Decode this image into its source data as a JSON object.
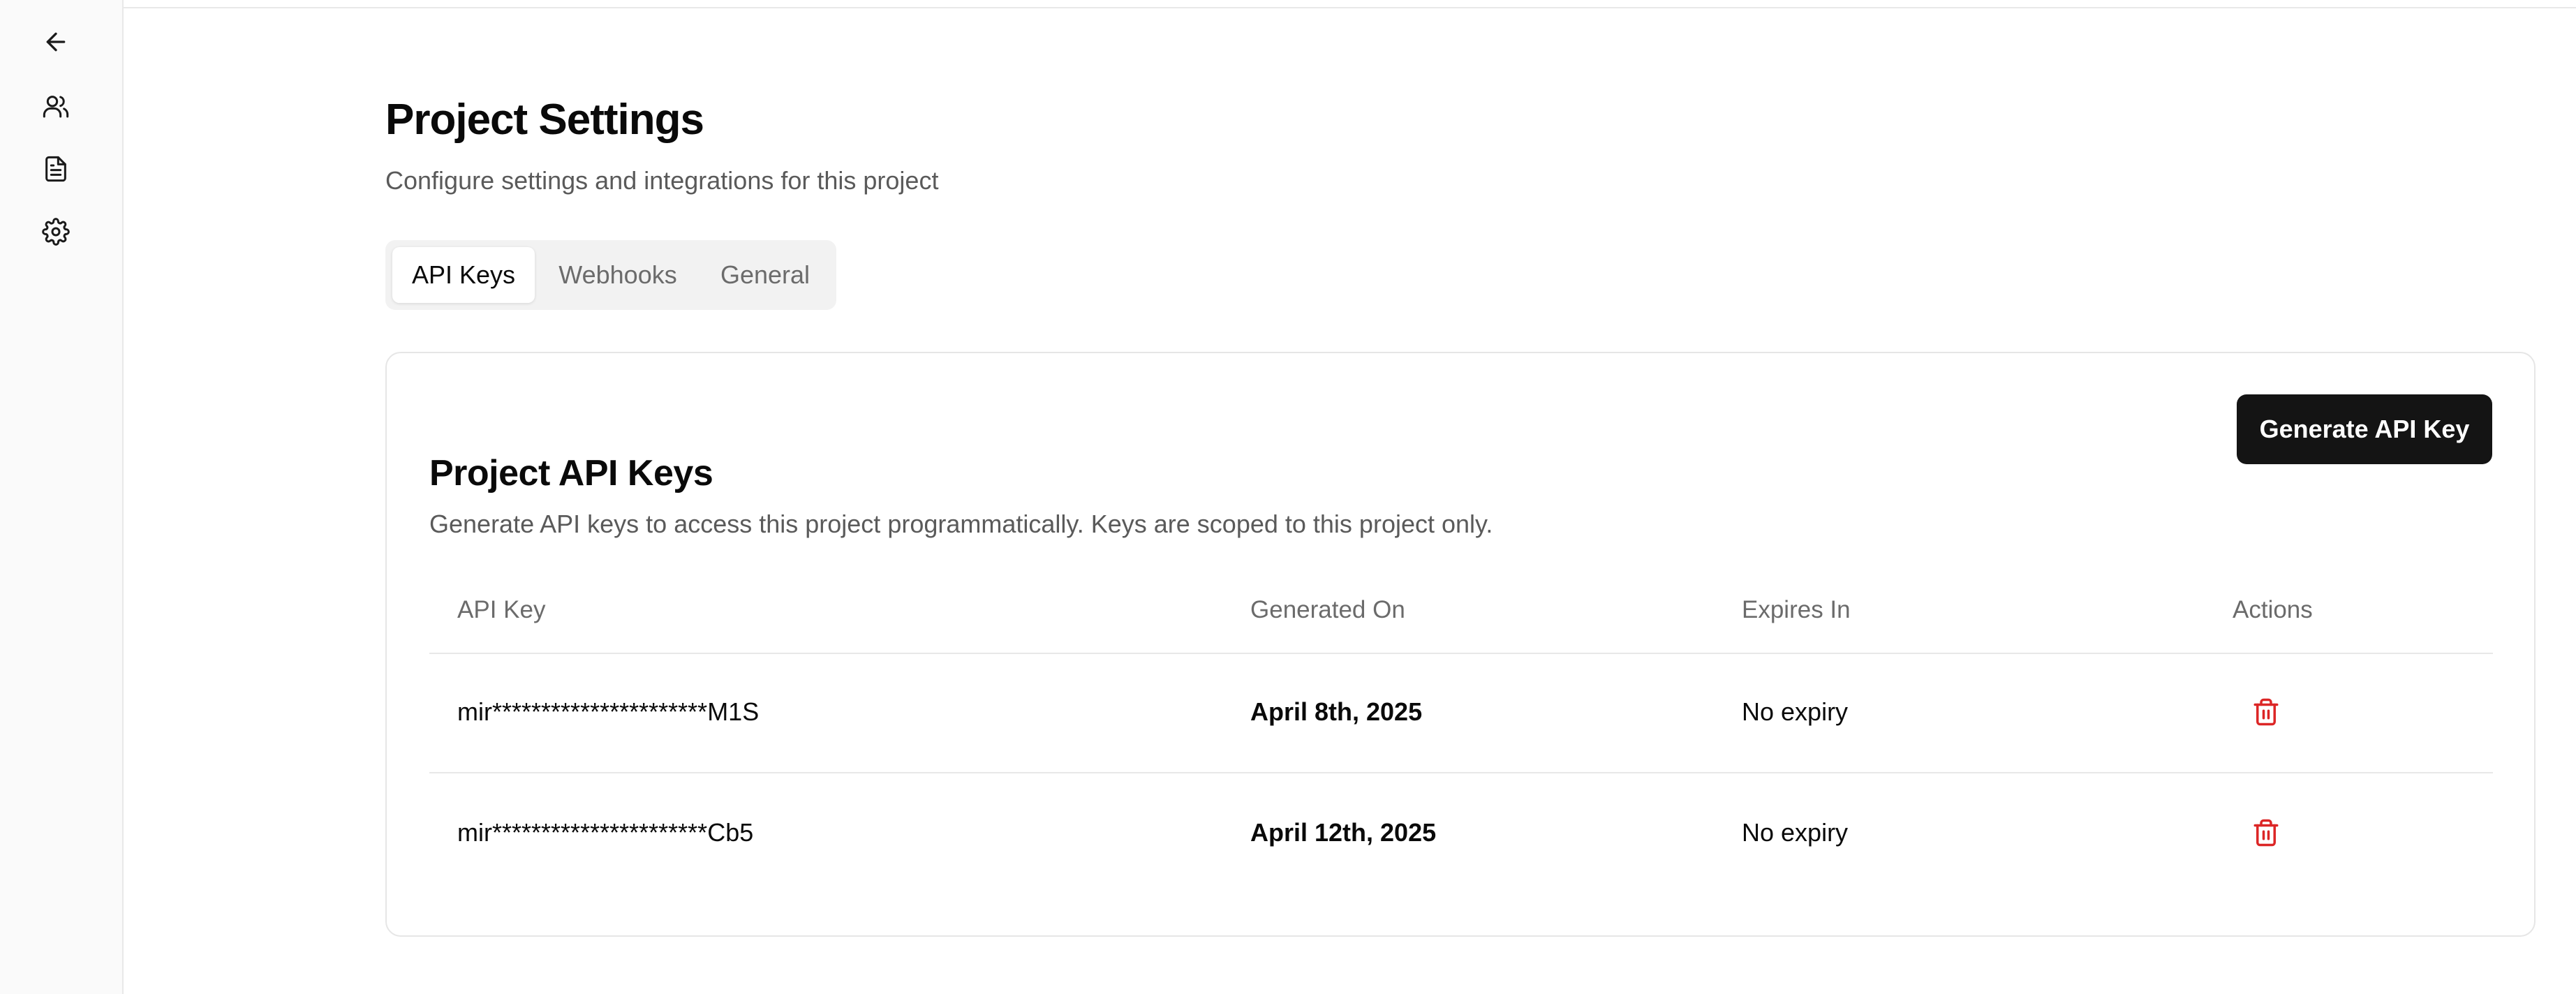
{
  "sidebar": {
    "items": [
      {
        "icon": "arrow-left-icon"
      },
      {
        "icon": "users-icon"
      },
      {
        "icon": "document-icon"
      },
      {
        "icon": "gear-icon"
      }
    ]
  },
  "header": {
    "title": "Project Settings",
    "subtitle": "Configure settings and integrations for this project"
  },
  "tabs": [
    {
      "label": "API Keys",
      "active": true
    },
    {
      "label": "Webhooks",
      "active": false
    },
    {
      "label": "General",
      "active": false
    }
  ],
  "api_keys_card": {
    "title": "Project API Keys",
    "description": "Generate API keys to access this project programmatically. Keys are scoped to this project only.",
    "generate_button_label": "Generate API Key",
    "columns": [
      "API Key",
      "Generated On",
      "Expires In",
      "Actions"
    ],
    "rows": [
      {
        "key": "mir**********************M1S",
        "generated_on": "April 8th, 2025",
        "expires_in": "No expiry"
      },
      {
        "key": "mir**********************Cb5",
        "generated_on": "April 12th, 2025",
        "expires_in": "No expiry"
      }
    ]
  },
  "colors": {
    "accent": "#141414",
    "danger": "#dc2626",
    "muted_text": "#5a5a5a"
  }
}
